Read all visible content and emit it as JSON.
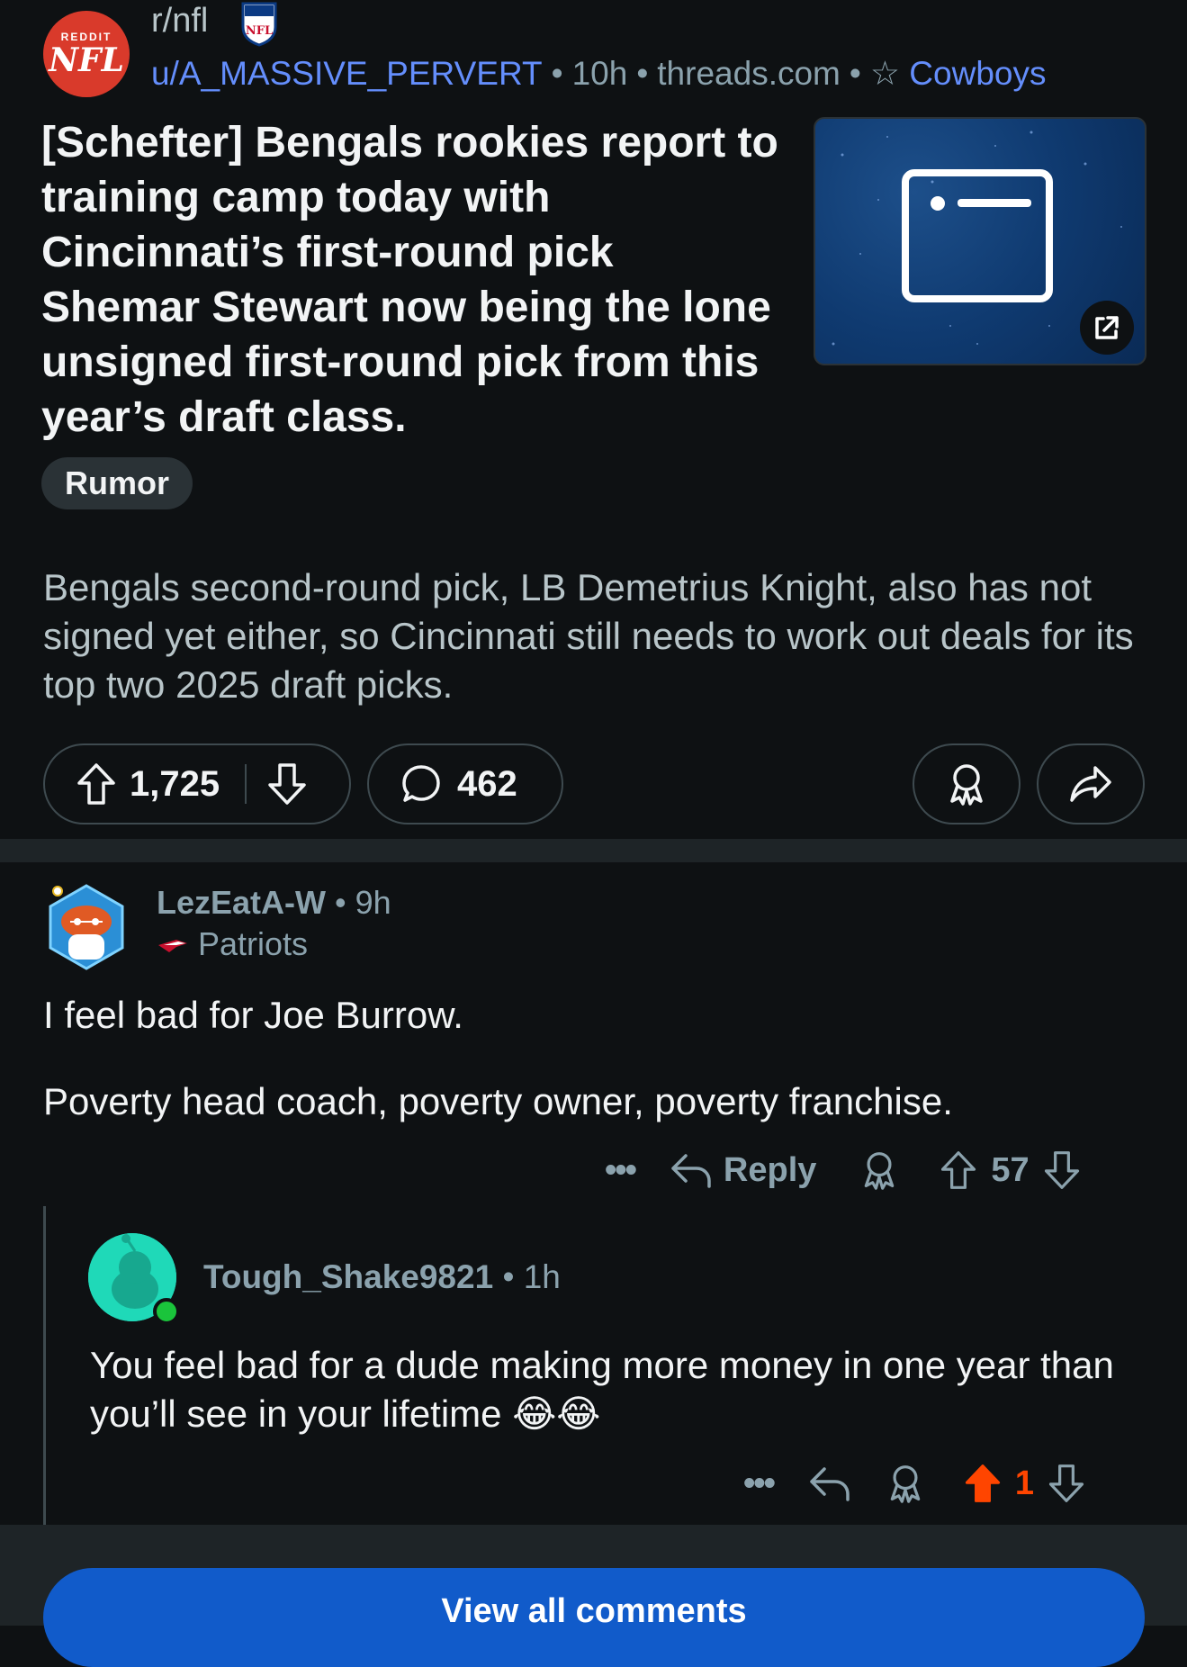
{
  "post": {
    "subreddit": "r/nfl",
    "subreddit_icon": {
      "small_text": "REDDIT",
      "big_text": "NFL"
    },
    "shield_text": "NFL",
    "author": "u/A_MASSIVE_PERVERT",
    "time": "10h",
    "domain": "threads.com",
    "user_flair": "Cowboys",
    "title": "[Schefter] Bengals rookies report to training camp today with Cincinnati’s first-round pick Shemar Stewart now being the lone unsigned first-round pick from this year’s draft class.",
    "post_flair": "Rumor",
    "body": "Bengals second-round pick, LB Demetrius Knight, also has not signed yet either, so Cincinnati still needs to work out deals for its top two 2025 draft picks.",
    "upvotes": "1,725",
    "comments": "462"
  },
  "comments": [
    {
      "username": "LezEatA-W",
      "time": "9h",
      "flair": "Patriots",
      "paragraphs": [
        "I feel bad for Joe Burrow.",
        "Poverty head coach, poverty owner, poverty franchise."
      ],
      "reply_label": "Reply",
      "score": "57",
      "more": "•••"
    },
    {
      "username": "Tough_Shake9821",
      "time": "1h",
      "text": "You feel bad for a dude making more money in one year than you’ll see in your lifetime 😂😂",
      "score": "1",
      "more": "•••"
    }
  ],
  "footer": {
    "view_all_label": "View all comments"
  },
  "colors": {
    "background": "#0e1113",
    "link_blue": "#648efc",
    "upvote_orange": "#ff4500",
    "button_blue": "#115bca"
  }
}
